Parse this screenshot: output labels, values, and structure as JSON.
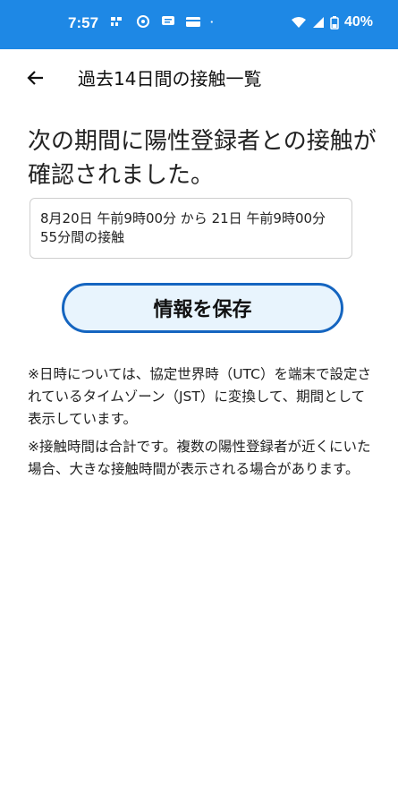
{
  "status_bar": {
    "time": "7:57",
    "battery": "40%",
    "background": "#1e88e5",
    "icons_left": [
      "notification-icon",
      "message-icon",
      "chat-icon",
      "card-icon",
      "dot-icon"
    ],
    "icons_right": [
      "wifi-icon",
      "signal-icon",
      "battery-icon"
    ]
  },
  "header": {
    "title": "過去14日間の接触一覧"
  },
  "main": {
    "headline": "次の期間に陽性登録者との接触が確認されました。",
    "contact_period": "8月20日 午前9時00分 から 21日 午前9時00分",
    "contact_duration": "55分間の接触",
    "save_button_label": "情報を保存",
    "note_time": "※日時については、協定世界時（UTC）を端末で設定されているタイムゾーン（JST）に変換して、期間として表示しています。",
    "note_duration": "※接触時間は合計です。複数の陽性登録者が近くにいた場合、大きな接触時間が表示される場合があります。"
  },
  "colors": {
    "accent": "#1565c0",
    "button_fill": "#e8f4fd"
  }
}
